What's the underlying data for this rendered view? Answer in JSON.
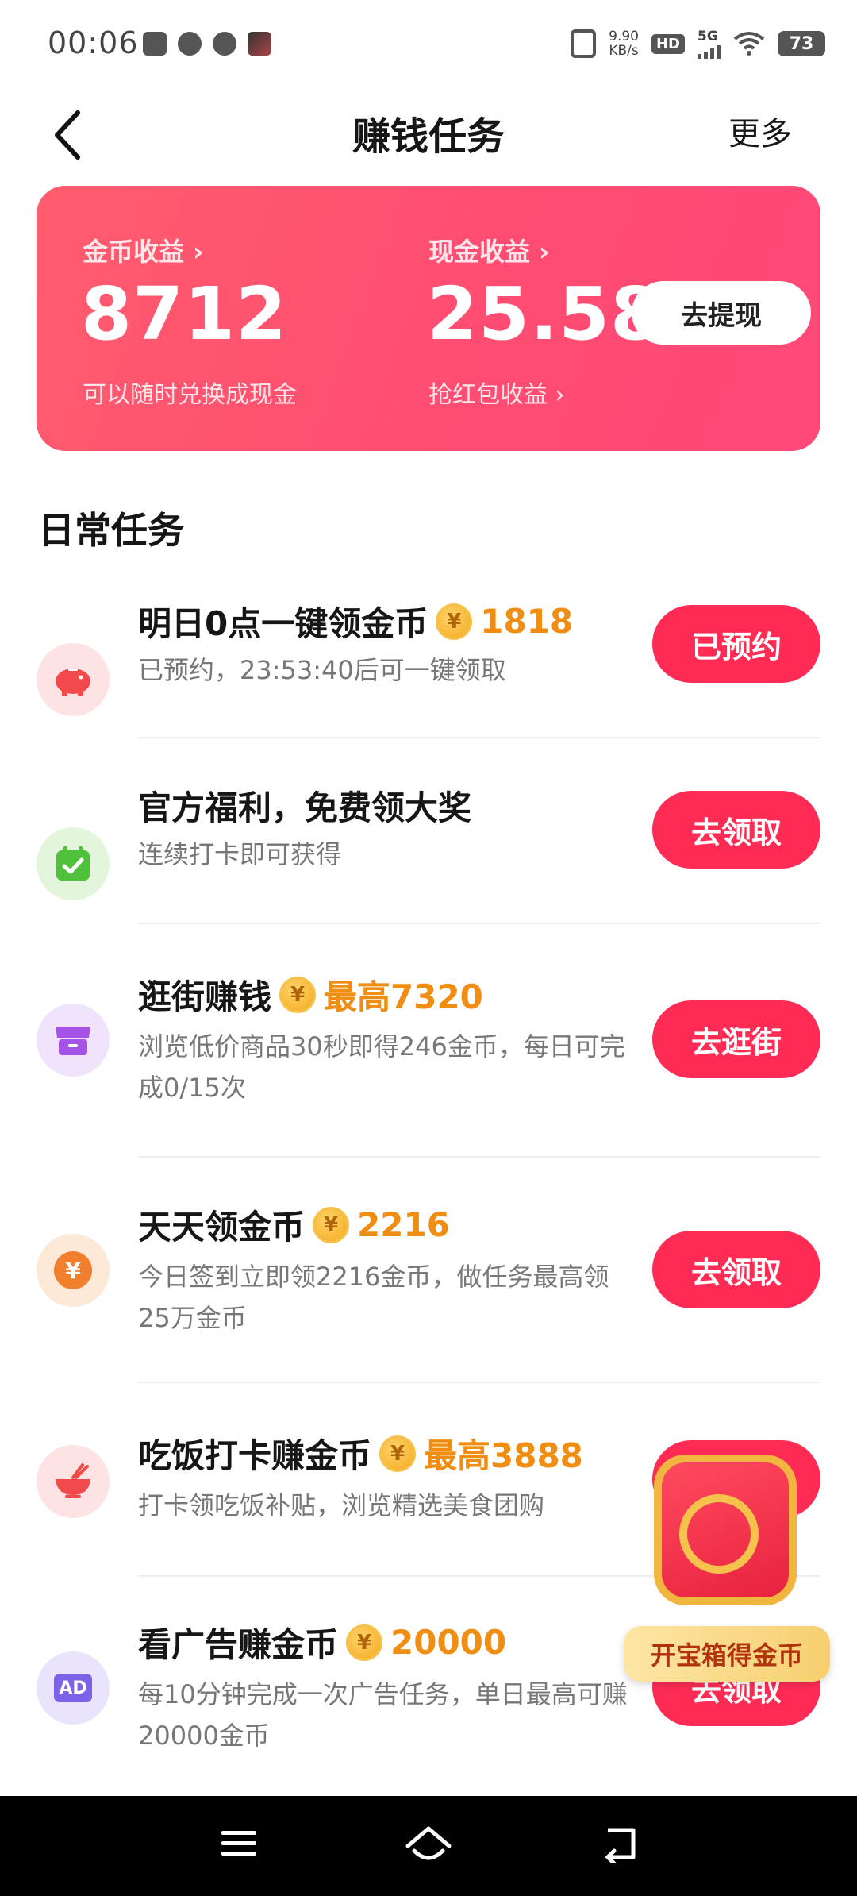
{
  "status_bar": {
    "time": "00:06",
    "net_speed_value": "9.90",
    "net_speed_unit": "KB/s",
    "hd_badge": "HD",
    "network": "5G",
    "battery": "73"
  },
  "header": {
    "title": "赚钱任务",
    "more_label": "更多"
  },
  "earnings": {
    "coin_label": "金币收益 ›",
    "coin_value": "8712",
    "coin_sub": "可以随时兑换成现金",
    "cash_label": "现金收益 ›",
    "cash_value": "25.58",
    "cash_sub": "抢红包收益 ›",
    "withdraw_button": "去提现"
  },
  "section": {
    "title": "日常任务"
  },
  "tasks": [
    {
      "icon": "piggy-bank-icon",
      "title": "明日0点一键领金币",
      "reward": "1818",
      "desc": "已预约，23:53:40后可一键领取",
      "button": "已预约"
    },
    {
      "icon": "calendar-check-icon",
      "title": "官方福利，免费领大奖",
      "reward": "",
      "desc": "连续打卡即可获得",
      "button": "去领取"
    },
    {
      "icon": "store-icon",
      "title": "逛街赚钱",
      "reward": "最高7320",
      "desc": "浏览低价商品30秒即得246金币，每日可完成0/15次",
      "button": "去逛街"
    },
    {
      "icon": "yuan-coin-icon",
      "title": "天天领金币",
      "reward": "2216",
      "desc": "今日签到立即领2216金币，做任务最高领25万金币",
      "button": "去领取"
    },
    {
      "icon": "rice-bowl-icon",
      "title": "吃饭打卡赚金币",
      "reward": "最高3888",
      "desc": "打卡领吃饭补贴，浏览精选美食团购",
      "button": "去领取"
    },
    {
      "icon": "ad-icon",
      "title": "看广告赚金币",
      "reward": "20000",
      "desc": "每10分钟完成一次广告任务，单日最高可赚20000金币",
      "button": "去领取"
    }
  ],
  "floating": {
    "label": "开宝箱得金币"
  },
  "coin_symbol": "¥",
  "ad_badge": "AD",
  "colors": {
    "accent": "#fe2c55",
    "reward": "#ef8e12",
    "card_gradient_start": "#ff5c6e",
    "card_gradient_end": "#ff4979"
  }
}
